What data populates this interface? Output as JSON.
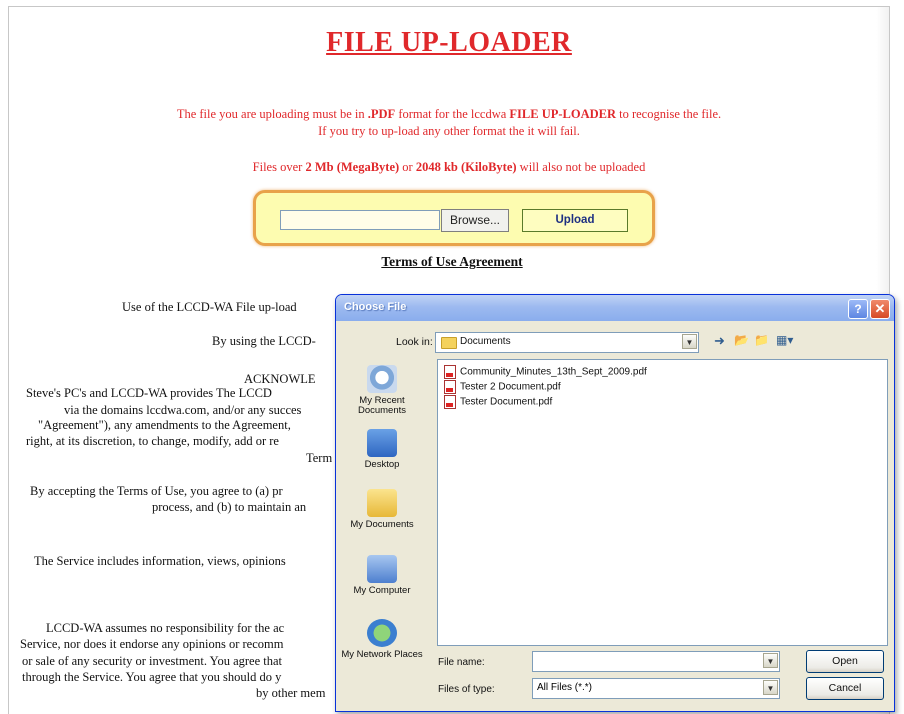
{
  "page": {
    "title": "FILE UP-LOADER",
    "notice_line1_a": "The file you are uploading must be in ",
    "notice_line1_b": ".PDF",
    "notice_line1_c": " format for the lccdwa ",
    "notice_line1_d": "FILE UP-LOADER",
    "notice_line1_e": " to recognise the file.",
    "notice_line2": "If you try to up-load any other format the it will fail.",
    "size_a": "Files over ",
    "size_b": "2 Mb (MegaByte)",
    "size_c": " or ",
    "size_d": "2048 kb (KiloByte)",
    "size_e": " will also not be uploaded",
    "browse_label": "Browse...",
    "upload_label": "Upload",
    "terms_title": "Terms of Use Agreement",
    "body_lines": [
      "Use of the LCCD-WA File up-load",
      "By using the LCCD-",
      "ACKNOWLE",
      "Steve's PC's and LCCD-WA provides The LCCD",
      "via the domains lccdwa.com, and/or any succes",
      "\"Agreement\"), any amendments to the Agreement,",
      "right, at its discretion, to change, modify, add or re",
      "Term",
      "By accepting the Terms of Use, you agree to (a) pr",
      "process, and (b) to maintain an",
      "The Service includes information, views, opinions",
      "LCCD-WA assumes no responsibility for the ac",
      "Service, nor does it endorse any opinions or recomm",
      "or sale of any security or investment. You agree that",
      "through the Service. You agree that you should do y",
      "by other mem"
    ]
  },
  "dialog": {
    "title": "Choose File",
    "help_glyph": "?",
    "close_glyph": "✕",
    "look_in_label": "Look in:",
    "look_in_value": "Documents",
    "places": [
      "My Recent Documents",
      "Desktop",
      "My Documents",
      "My Computer",
      "My Network Places"
    ],
    "files": [
      "Community_Minutes_13th_Sept_2009.pdf",
      "Tester 2 Document.pdf",
      "Tester Document.pdf"
    ],
    "file_name_label": "File name:",
    "file_name_value": "",
    "files_of_type_label": "Files of type:",
    "files_of_type_value": "All Files (*.*)",
    "open_label": "Open",
    "cancel_label": "Cancel"
  }
}
